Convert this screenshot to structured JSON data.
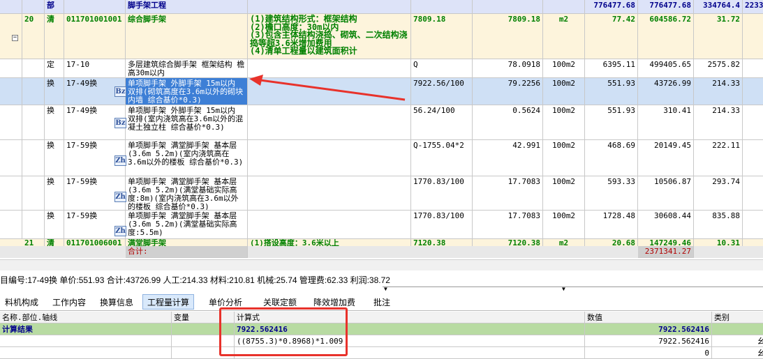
{
  "section_row": {
    "code": "部",
    "name": "脚手架工程",
    "total_price": "776477.68",
    "total2": "776477.68",
    "labor": "334764.4",
    "extra": "2233"
  },
  "item_20": {
    "seq": "20",
    "type": "清",
    "code": "011701001001",
    "name": "综合脚手架",
    "features": "(1)建筑结构形式：框架结构\n(2)檐口高度：30m以内\n(3)包含主体结构浇捣、砌筑、二次结构浇捣等超3.6米增加费用\n(4)清单工程量以建筑面积计",
    "expr": "7809.18",
    "qty": "7809.18",
    "unit": "m2",
    "unit_price": "77.42",
    "total": "604586.72",
    "labor": "31.72"
  },
  "rows": [
    {
      "type": "定",
      "code": "17-10",
      "name": "多层建筑综合脚手架 框架结构 檐高30m以内",
      "icon": "",
      "expr": "Q",
      "qty": "78.0918",
      "unit": "100m2",
      "price": "6395.11",
      "total": "499405.65",
      "labor": "2575.82"
    },
    {
      "type": "换",
      "code": "17-49换",
      "name": "单项脚手架 外脚手架 15m以内 双排(砌筑高度在3.6m以外的砌块内墙 综合基价*0.3)",
      "icon": "Bz",
      "expr": "7922.56/100",
      "qty": "79.2256",
      "unit": "100m2",
      "price": "551.93",
      "total": "43726.99",
      "labor": "214.33"
    },
    {
      "type": "换",
      "code": "17-49换",
      "name": "单项脚手架 外脚手架 15m以内 双排(室内浇筑高在3.6m以外的混凝土独立柱 综合基价*0.3)",
      "icon": "Bz",
      "expr": "56.24/100",
      "qty": "0.5624",
      "unit": "100m2",
      "price": "551.93",
      "total": "310.41",
      "labor": "214.33"
    },
    {
      "type": "换",
      "code": "17-59换",
      "name": "单项脚手架 满堂脚手架 基本层(3.6m 5.2m)(室内浇筑高在3.6m以外的楼板 综合基价*0.3)",
      "icon": "Zh",
      "expr": "Q-1755.04*2",
      "qty": "42.991",
      "unit": "100m2",
      "price": "468.69",
      "total": "20149.45",
      "labor": "222.11"
    },
    {
      "type": "换",
      "code": "17-59换",
      "name": "单项脚手架 满堂脚手架 基本层(3.6m 5.2m)(满堂基础实际高度:8m)(室内浇筑高在3.6m以外的楼板 综合基价*0.3)",
      "icon": "Zh",
      "expr": "1770.83/100",
      "qty": "17.7083",
      "unit": "100m2",
      "price": "593.33",
      "total": "10506.87",
      "labor": "293.74"
    },
    {
      "type": "换",
      "code": "17-59换",
      "name": "单项脚手架 满堂脚手架 基本层(3.6m 5.2m)(满堂基础实际高度:5.5m)",
      "icon": "Zh",
      "expr": "1770.83/100",
      "qty": "17.7083",
      "unit": "100m2",
      "price": "1728.48",
      "total": "30608.44",
      "labor": "835.88"
    }
  ],
  "item_21": {
    "seq": "21",
    "type": "清",
    "code": "011701006001",
    "name": "满堂脚手架",
    "features": "(1)搭设高度：3.6米以上",
    "expr": "7120.38",
    "qty": "7120.38",
    "unit": "m2",
    "unit_price": "20.68",
    "total": "147249.46",
    "labor": "10.31"
  },
  "footer": {
    "label": "合计:",
    "total": "2371341.27"
  },
  "info_bar": "目编号:17-49换  单价:551.93  合计:43726.99  人工:214.33  材料:210.81  机械:25.74  管理费:62.33  利润:38.72",
  "tabs": [
    "料机构成",
    "工作内容",
    "换算信息",
    "工程量计算",
    "单价分析",
    "关联定额",
    "降效增加费",
    "批注"
  ],
  "active_tab": "工程量计算",
  "calc_table": {
    "headers": {
      "name": "名称.部位.轴线",
      "var": "变量",
      "formula": "计算式",
      "value": "数值",
      "category": "类别"
    },
    "result_row": {
      "name": "计算结果",
      "formula": "7922.562416",
      "value": "7922.562416"
    },
    "row1": {
      "formula": "((8755.3)*0.8968)*1.009",
      "value": "7922.562416",
      "category": "幺"
    },
    "row2": {
      "value": "0",
      "category": "幺"
    }
  },
  "colors": {
    "arrow": "#e8322b",
    "highlight": "#3d7fd6",
    "box": "#e8322b"
  }
}
